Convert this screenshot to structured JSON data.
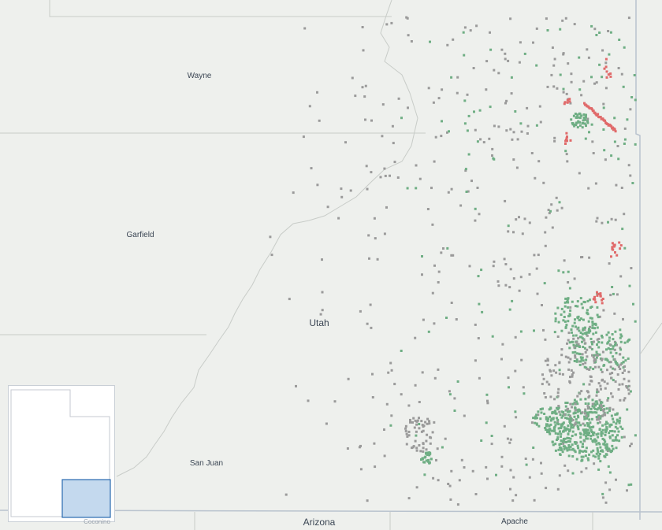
{
  "map": {
    "counties": {
      "wayne": "Wayne",
      "garfield": "Garfield",
      "san_juan": "San Juan",
      "apache": "Apache",
      "coconino": "Coconino"
    },
    "states": {
      "utah": "Utah",
      "arizona": "Arizona"
    },
    "colors": {
      "background": "#eef0ed",
      "boundary": "#c8ccc8",
      "state_line": "#b9c3ce",
      "point_gray": "#9a9a9a",
      "point_green": "#6fae84",
      "point_red": "#e06a6a",
      "extent_fill": "#c4d9ee",
      "extent_stroke": "#2a6ab0"
    }
  },
  "minimap": {
    "highlight": "current-view"
  }
}
